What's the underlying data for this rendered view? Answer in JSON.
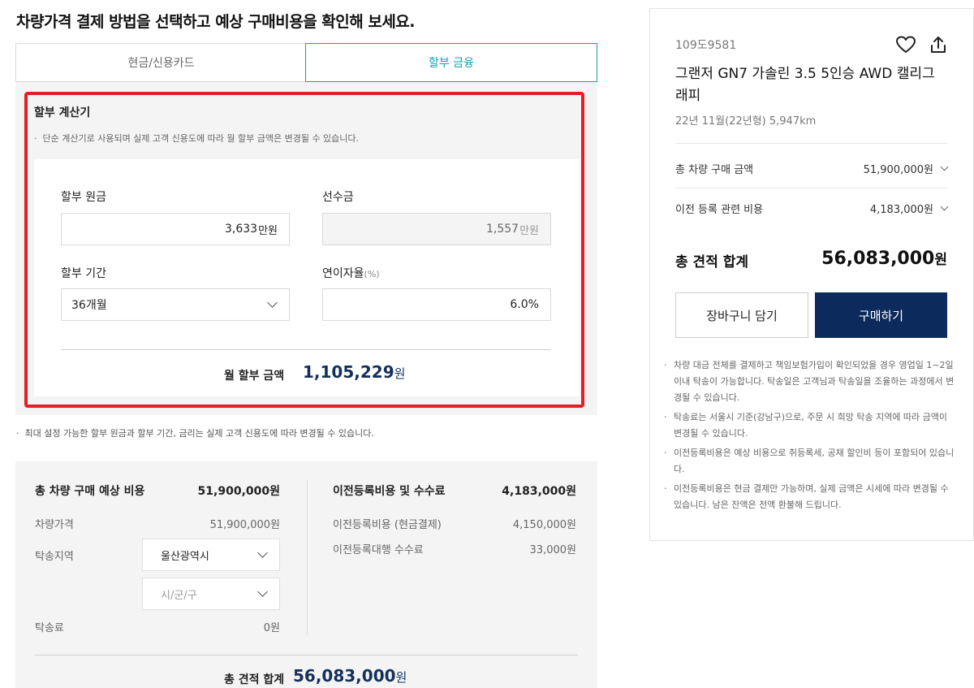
{
  "page_title": "차량가격 결제 방법을 선택하고 예상 구매비용을 확인해 보세요.",
  "tabs": [
    {
      "label": "현금/신용카드",
      "active": false
    },
    {
      "label": "할부 금융",
      "active": true
    }
  ],
  "calculator": {
    "title": "할부 계산기",
    "note": "단순 계산기로 사용되며 실제 고객 신용도에 따라 월 할부 금액은 변경될 수 있습니다.",
    "principal_label": "할부 원금",
    "principal_value": "3,633",
    "principal_unit": "만원",
    "down_payment_label": "선수금",
    "down_payment_value": "1,557",
    "down_payment_unit": "만원",
    "term_label": "할부 기간",
    "term_value": "36개월",
    "rate_label": "연이자율",
    "rate_unit_label": "(%)",
    "rate_value": "6.0%",
    "monthly_label": "월 할부 금액",
    "monthly_value": "1,105,229",
    "monthly_unit": "원"
  },
  "below_note": "최대 설정 가능한 할부 원금과 할부 기간, 금리는 실제 고객 신용도에 따라 변경될 수 있습니다.",
  "estimate": {
    "vehicle_header": "총 차량 구매 예상 비용",
    "vehicle_header_value": "51,900,000원",
    "price_label": "차량가격",
    "price_value": "51,900,000원",
    "delivery_region_label": "탁송지역",
    "region_city": "울산광역시",
    "region_district_placeholder": "시/군/구",
    "delivery_fee_label": "탁송료",
    "delivery_fee_value": "0원",
    "transfer_header": "이전등록비용 및 수수료",
    "transfer_header_value": "4,183,000원",
    "transfer_fee_label": "이전등록비용 (현금결제)",
    "transfer_fee_value": "4,150,000원",
    "agency_fee_label": "이전등록대행 수수료",
    "agency_fee_value": "33,000원",
    "total_label": "총 견적 합계",
    "total_value": "56,083,000",
    "total_unit": "원"
  },
  "card": {
    "plate": "109도9581",
    "car_name": "그랜저 GN7 가솔린 3.5 5인승 AWD 캘리그래피",
    "car_sub": "22년 11월(22년형) 5,947km",
    "rows": [
      {
        "label": "총 차량 구매 금액",
        "value": "51,900,000원"
      },
      {
        "label": "이전 등록 관련 비용",
        "value": "4,183,000원"
      }
    ],
    "total_label": "총 견적 합계",
    "total_value": "56,083,000",
    "total_unit": "원",
    "cart_button": "장바구니 담기",
    "buy_button": "구매하기",
    "notes": [
      "차량 대금 전체를 결제하고 책임보험가입이 확인되었을 경우 영업일 1~2일 이내 탁송이 가능합니다. 탁송일은 고객님과 탁송일을 조율하는 과정에서 변경될 수 있습니다.",
      "탁송료는 서울시 기준(강남구)으로, 주문 시 희망 탁송 지역에 따라 금액이 변경될 수 있습니다.",
      "이전등록비용은 예상 비용으로 취등록세, 공채 할인비 등이 포함되어 있습니다.",
      "이전등록비용은 현금 결제만 가능하며, 실제 금액은 시세에 따라 변경될 수 있습니다. 남은 잔액은 전액 환불해 드립니다."
    ]
  },
  "colors": {
    "accent": "#0fa3b1",
    "highlight_red": "#e41e25",
    "navy": "#0c2a5b"
  }
}
